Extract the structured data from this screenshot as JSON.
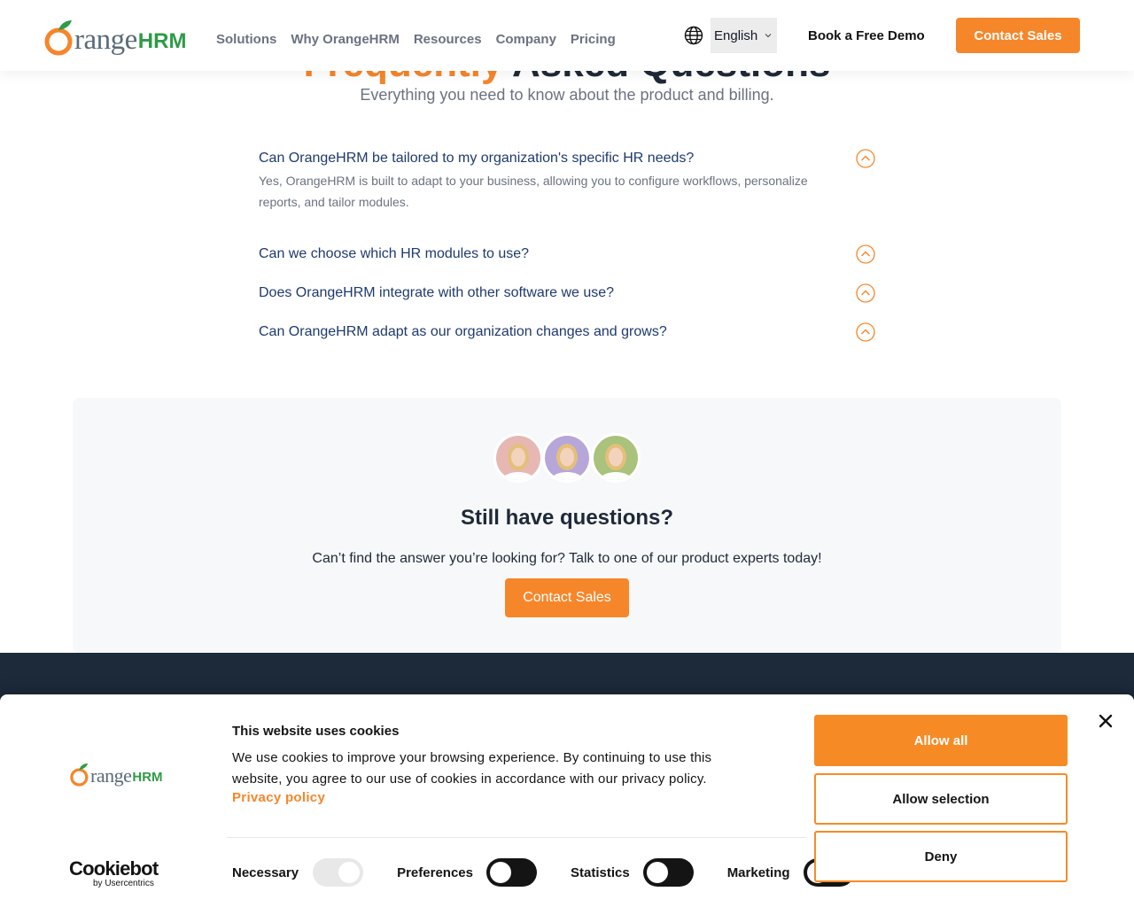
{
  "brand": {
    "name_main": "Orange",
    "name_suffix": "HRM",
    "logo_letter": "range"
  },
  "header": {
    "nav": [
      "Solutions",
      "Why OrangeHRM",
      "Resources",
      "Company",
      "Pricing"
    ],
    "language": "English",
    "demo_label": "Book a Free Demo",
    "contact_label": "Contact Sales",
    "globe_icon": "globe-icon"
  },
  "faq": {
    "title_accent": "Frequently",
    "title_rest": "Asked Questions",
    "subtitle": "Everything you need to know about the product and billing.",
    "items": [
      {
        "q": "Can OrangeHRM be tailored to my organization's specific HR needs?",
        "a": "Yes, OrangeHRM is built to adapt to your business, allowing you to configure workflows, personalize reports, and tailor modules."
      },
      {
        "q": "Can we choose which HR modules to use?",
        "a": ""
      },
      {
        "q": "Does OrangeHRM integrate with other software we use?",
        "a": ""
      },
      {
        "q": "Can OrangeHRM adapt as our organization changes and grows?",
        "a": ""
      }
    ]
  },
  "cta": {
    "title": "Still have questions?",
    "text": "Can’t find the answer you’re looking for? Talk to one of our product experts today!",
    "button": "Contact Sales",
    "avatar_bg": [
      "#e6b7b3",
      "#b7a6d9",
      "#a9c27c"
    ]
  },
  "cookie": {
    "title": "This website uses cookies",
    "body": "We use cookies to improve your browsing experience. By continuing to use this website, you agree to our use of cookies in accordance with our privacy policy.",
    "privacy_link": "Privacy policy",
    "powered_name": "Cookiebot",
    "powered_sub": "by Usercentrics",
    "toggles": [
      {
        "label": "Necessary",
        "on": true
      },
      {
        "label": "Preferences",
        "on": false
      },
      {
        "label": "Statistics",
        "on": false
      },
      {
        "label": "Marketing",
        "on": false
      }
    ],
    "allow_all": "Allow all",
    "allow_selection": "Allow selection",
    "deny": "Deny"
  },
  "colors": {
    "accent": "#f6862a",
    "brand_green": "#2e9b47",
    "navy_text": "#1e3a6e",
    "footer": "#1d2a3a"
  }
}
